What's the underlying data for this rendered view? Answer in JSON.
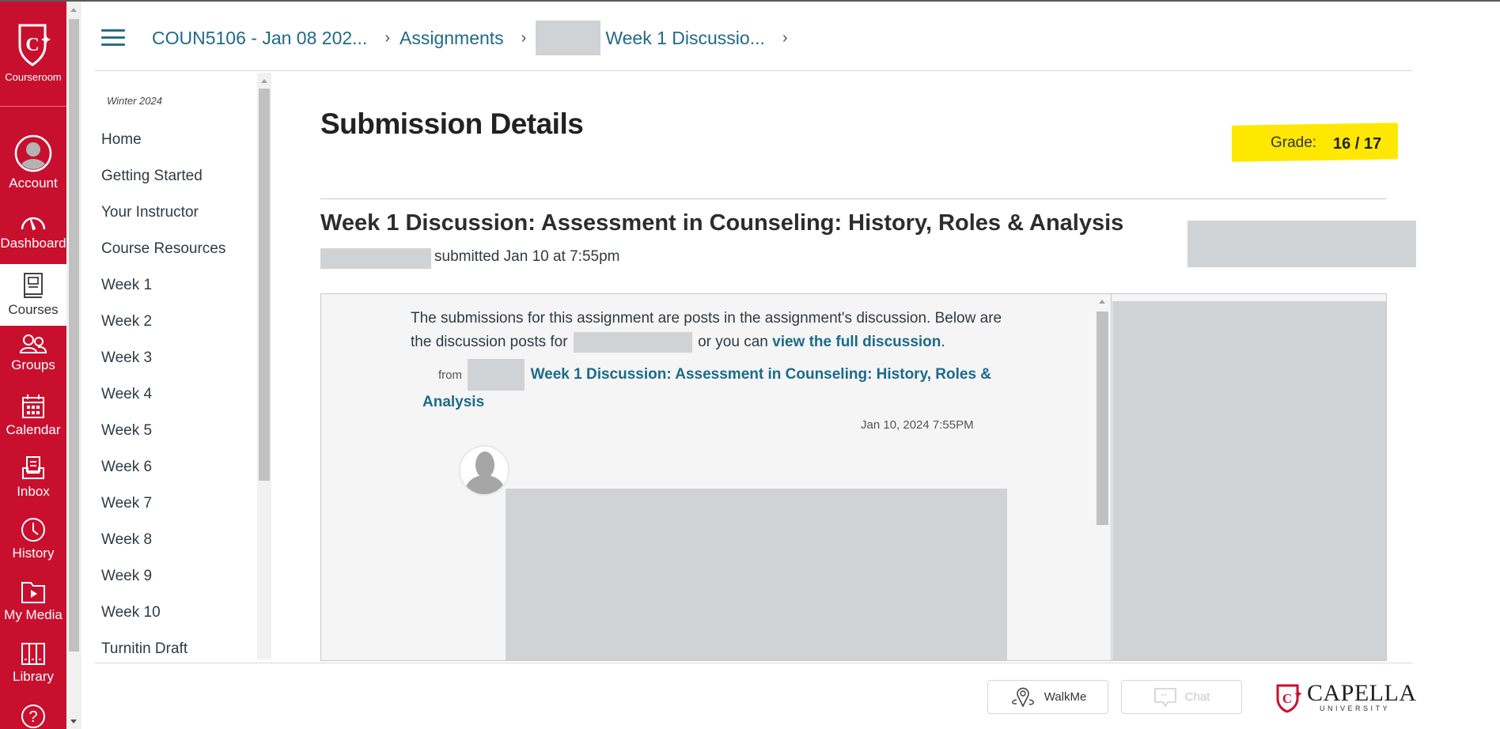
{
  "global_nav": {
    "brand_label": "Courseroom",
    "items": [
      {
        "label": "Account",
        "icon": "account-avatar-icon"
      },
      {
        "label": "Dashboard",
        "icon": "dashboard-gauge-icon"
      },
      {
        "label": "Courses",
        "icon": "courses-book-icon",
        "active": true
      },
      {
        "label": "Groups",
        "icon": "groups-icon"
      },
      {
        "label": "Calendar",
        "icon": "calendar-icon"
      },
      {
        "label": "Inbox",
        "icon": "inbox-icon"
      },
      {
        "label": "History",
        "icon": "clock-icon"
      },
      {
        "label": "My Media",
        "icon": "media-folder-icon"
      },
      {
        "label": "Library",
        "icon": "library-icon"
      },
      {
        "label": "",
        "icon": "help-icon"
      }
    ],
    "brand_color": "#c8102e"
  },
  "breadcrumb": {
    "items": [
      {
        "label": "COUN5106 - Jan 08 202..."
      },
      {
        "label": "Assignments"
      },
      {
        "label": "Week 1 Discussio..."
      }
    ],
    "link_color": "#1f6a86"
  },
  "course_nav": {
    "term": "Winter 2024",
    "items": [
      "Home",
      "Getting Started",
      "Your Instructor",
      "Course Resources",
      "Week 1",
      "Week 2",
      "Week 3",
      "Week 4",
      "Week 5",
      "Week 6",
      "Week 7",
      "Week 8",
      "Week 9",
      "Week 10",
      "Turnitin Draft"
    ]
  },
  "main": {
    "page_title": "Submission Details",
    "grade_label": "Grade:",
    "grade_value": "16 / 17",
    "grade_highlight_color": "#ffe800",
    "assignment_title": "Week 1 Discussion: Assessment in Counseling: History, Roles & Analysis",
    "submitted_text": "submitted Jan 10 at 7:55pm",
    "intro_part1": "The submissions for this assignment are posts in the assignment's discussion. Below are the discussion posts for",
    "intro_part2": "or you can",
    "intro_link": "view the full discussion",
    "intro_end": ".",
    "from_label": "from",
    "discussion_link": "Week 1 Discussion: Assessment in Counseling: History, Roles & Analysis",
    "post_date": "Jan 10, 2024 7:55PM"
  },
  "footer": {
    "walkme_label": "WalkMe",
    "chat_label": "Chat",
    "logo_name": "CAPELLA",
    "logo_sub": "UNIVERSITY"
  }
}
